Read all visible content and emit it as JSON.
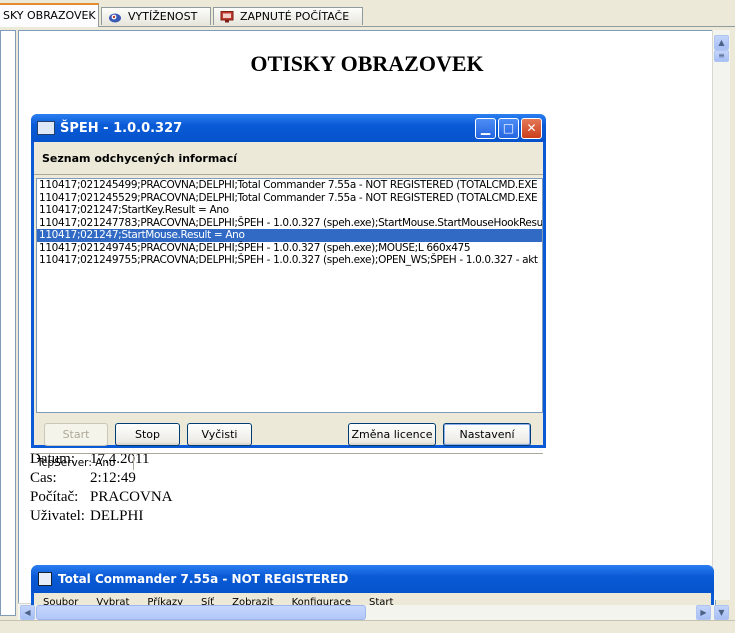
{
  "tabs": [
    {
      "label": "SKY OBRAZOVEK",
      "icon": "document-icon",
      "active": true
    },
    {
      "label": "VYTÍŽENOST",
      "icon": "performance-icon",
      "active": false
    },
    {
      "label": "ZAPNUTÉ POČÍTAČE",
      "icon": "monitor-icon",
      "active": false
    }
  ],
  "document": {
    "title": "OTISKY OBRAZOVEK",
    "info": [
      {
        "label": "Datum:",
        "value": "17.4.2011"
      },
      {
        "label": "Cas:",
        "value": "2:12:49"
      },
      {
        "label": "Počítač:",
        "value": "PRACOVNA"
      },
      {
        "label": "Uživatel:",
        "value": "DELPHI"
      }
    ]
  },
  "speh_window": {
    "title": "ŠPEH - 1.0.0.327",
    "section_title": "Seznam odchycených informací",
    "log": [
      "110417;021245499;PRACOVNA;DELPHI;Total Commander 7.55a - NOT REGISTERED (TOTALCMD.EXE",
      "110417;021245529;PRACOVNA;DELPHI;Total Commander 7.55a - NOT REGISTERED (TOTALCMD.EXE",
      "110417;021247;StartKey.Result = Ano",
      "110417;021247783;PRACOVNA;DELPHI;ŠPEH - 1.0.0.327 (speh.exe);StartMouse.StartMouseHookResul",
      "110417;021247;StartMouse.Result = Ano",
      "110417;021249745;PRACOVNA;DELPHI;ŠPEH - 1.0.0.327 (speh.exe);MOUSE;L 660x475",
      "110417;021249755;PRACOVNA;DELPHI;ŠPEH - 1.0.0.327 (speh.exe);OPEN_WS;ŠPEH - 1.0.0.327 - akt"
    ],
    "selected_index": 4,
    "buttons": {
      "start": "Start",
      "stop": "Stop",
      "clear": "Vyčisti",
      "license": "Změna licence",
      "settings": "Nastavení"
    },
    "status": "TcpServer: Ano"
  },
  "tc_window": {
    "title": "Total Commander 7.55a - NOT REGISTERED",
    "menu": [
      "Soubor",
      "Vybrat",
      "Příkazy",
      "Síť",
      "Zobrazit",
      "Konfigurace",
      "Start"
    ]
  },
  "colors": {
    "xp_blue": "#0a5ad6",
    "selection": "#316ac5",
    "active_tab_accent": "#e68b2c"
  }
}
